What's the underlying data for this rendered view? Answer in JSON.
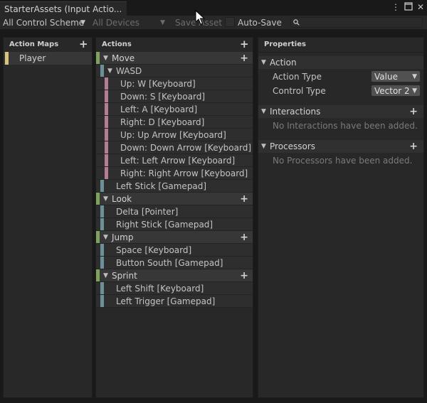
{
  "window": {
    "tab_title": "StarterAssets (Input Actio...",
    "menu_icon": "kebab-menu-icon",
    "maximize_icon": "maximize-icon",
    "close_icon": "close-icon"
  },
  "toolbar": {
    "control_scheme": "All Control Scheme",
    "devices": "All Devices",
    "save_asset": "Save Asset",
    "auto_save": "Auto-Save",
    "search_icon": "search-icon"
  },
  "action_maps": {
    "header": "Action Maps",
    "items": [
      {
        "label": "Player",
        "color": "#d8c37f"
      }
    ]
  },
  "actions": {
    "header": "Actions",
    "rows": [
      {
        "kind": "action",
        "label": "Move",
        "color": "#7fa15e"
      },
      {
        "kind": "composite",
        "label": "WASD",
        "color": "#6d8f98"
      },
      {
        "kind": "part",
        "label": "Up: W [Keyboard]",
        "color": "#b57d93"
      },
      {
        "kind": "part",
        "label": "Down: S [Keyboard]",
        "color": "#b57d93"
      },
      {
        "kind": "part",
        "label": "Left: A [Keyboard]",
        "color": "#b57d93"
      },
      {
        "kind": "part",
        "label": "Right: D [Keyboard]",
        "color": "#b57d93"
      },
      {
        "kind": "part",
        "label": "Up: Up Arrow [Keyboard]",
        "color": "#b57d93"
      },
      {
        "kind": "part",
        "label": "Down: Down Arrow [Keyboard]",
        "color": "#b57d93"
      },
      {
        "kind": "part",
        "label": "Left: Left Arrow [Keyboard]",
        "color": "#b57d93"
      },
      {
        "kind": "part",
        "label": "Right: Right Arrow [Keyboard]",
        "color": "#b57d93"
      },
      {
        "kind": "binding",
        "label": "Left Stick [Gamepad]",
        "color": "#6d8f98"
      },
      {
        "kind": "action",
        "label": "Look",
        "color": "#7fa15e"
      },
      {
        "kind": "binding",
        "label": "Delta [Pointer]",
        "color": "#6d8f98"
      },
      {
        "kind": "binding",
        "label": "Right Stick [Gamepad]",
        "color": "#6d8f98"
      },
      {
        "kind": "action",
        "label": "Jump",
        "color": "#7fa15e"
      },
      {
        "kind": "binding",
        "label": "Space [Keyboard]",
        "color": "#6d8f98"
      },
      {
        "kind": "binding",
        "label": "Button South [Gamepad]",
        "color": "#6d8f98"
      },
      {
        "kind": "action",
        "label": "Sprint",
        "color": "#7fa15e"
      },
      {
        "kind": "binding",
        "label": "Left Shift [Keyboard]",
        "color": "#6d8f98"
      },
      {
        "kind": "binding",
        "label": "Left Trigger [Gamepad]",
        "color": "#6d8f98"
      }
    ]
  },
  "properties": {
    "header": "Properties",
    "action_section": "Action",
    "action_type_label": "Action Type",
    "action_type_value": "Value",
    "control_type_label": "Control Type",
    "control_type_value": "Vector 2",
    "interactions_section": "Interactions",
    "interactions_empty": "No Interactions have been added.",
    "processors_section": "Processors",
    "processors_empty": "No Processors have been added."
  }
}
